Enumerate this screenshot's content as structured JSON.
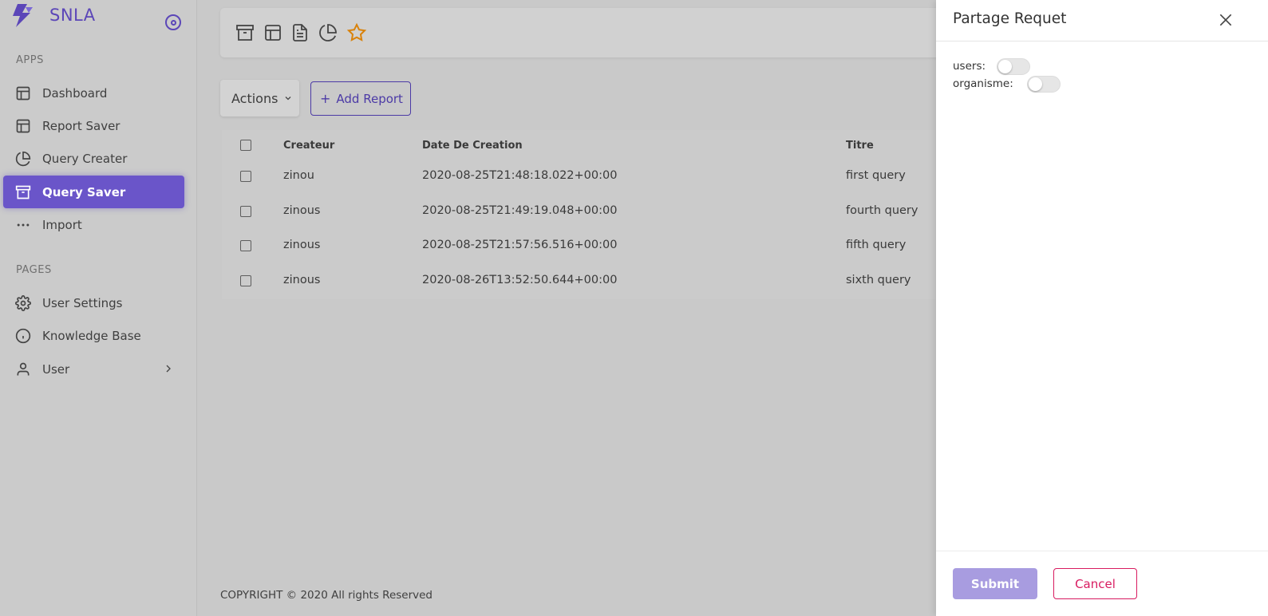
{
  "app": {
    "name": "SNLA",
    "accent": "#5b46b8"
  },
  "sidebar": {
    "sections": [
      {
        "label": "APPS"
      },
      {
        "label": "PAGES"
      }
    ],
    "items": [
      {
        "label": "Dashboard",
        "icon": "layout-icon"
      },
      {
        "label": "Report Saver",
        "icon": "layout-icon"
      },
      {
        "label": "Query Creater",
        "icon": "pie-chart-icon"
      },
      {
        "label": "Query Saver",
        "icon": "archive-icon",
        "active": true
      },
      {
        "label": "Import",
        "icon": "more-horizontal-icon"
      },
      {
        "label": "User Settings",
        "icon": "gear-icon"
      },
      {
        "label": "Knowledge Base",
        "icon": "info-icon"
      },
      {
        "label": "User",
        "icon": "user-icon"
      }
    ]
  },
  "toolbar": {
    "icons": [
      "archive-icon",
      "layout-icon",
      "file-text-icon",
      "pie-chart-icon",
      "star-icon"
    ]
  },
  "actions": {
    "label": "Actions",
    "add_report_label": "Add Report"
  },
  "table": {
    "headers": [
      "Createur",
      "Date De Creation",
      "Titre"
    ],
    "rows": [
      [
        "zinou",
        "2020-08-25T21:48:18.022+00:00",
        "first query"
      ],
      [
        "zinous",
        "2020-08-25T21:49:19.048+00:00",
        "fourth query"
      ],
      [
        "zinous",
        "2020-08-25T21:57:56.516+00:00",
        "fifth query"
      ],
      [
        "zinous",
        "2020-08-26T13:52:50.644+00:00",
        "sixth query"
      ]
    ]
  },
  "footer": {
    "text": "COPYRIGHT © 2020 All rights Reserved"
  },
  "drawer": {
    "title": "Partage Requet",
    "fields": [
      {
        "label": "users:",
        "checked": false
      },
      {
        "label": "organisme:",
        "checked": false
      }
    ],
    "submit_label": "Submit",
    "cancel_label": "Cancel"
  }
}
